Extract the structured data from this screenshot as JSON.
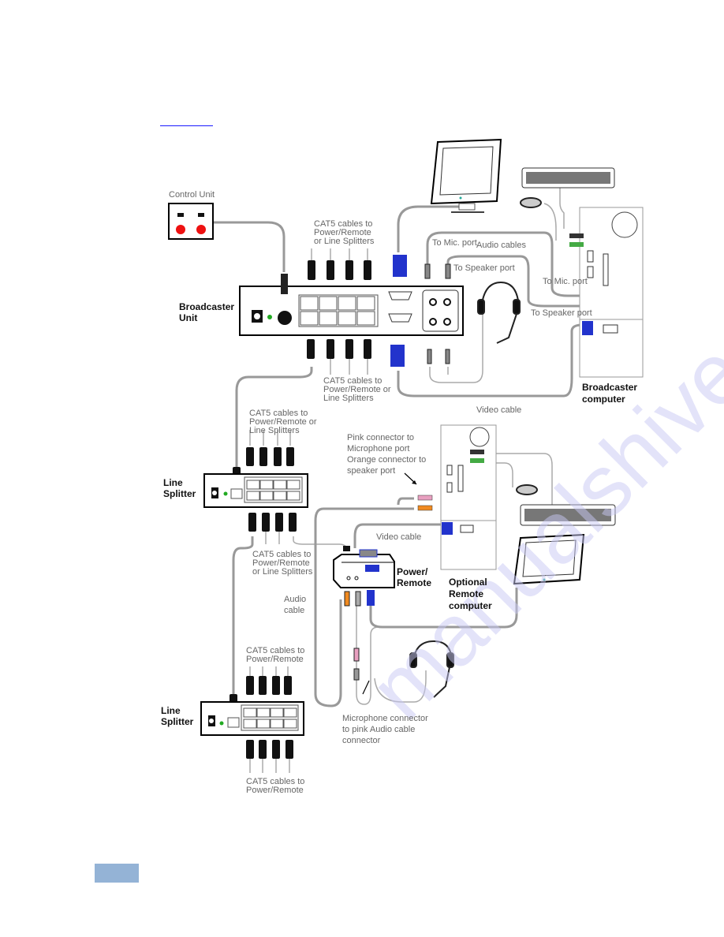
{
  "colors": {
    "link": "#1a1aff",
    "page_tab": "#94b3d6",
    "vga": "#2233cc",
    "led": "#22aa22",
    "button_red": "#ee1111",
    "pink": "#e8a0c0",
    "orange": "#f08a20",
    "green": "#44aa44"
  },
  "watermark": "manualshive.com",
  "labels": {
    "control_unit": "Control Unit",
    "broadcaster_unit": [
      "Broadcaster",
      "Unit"
    ],
    "cat5_top": [
      "CAT5 cables to",
      "Power/Remote",
      "or Line Splitters"
    ],
    "cat5_below_broadcaster": [
      "CAT5 cables to",
      "Power/Remote or",
      "Line Splitters"
    ],
    "to_mic_1": "To Mic. port",
    "audio_cables": "Audio cables",
    "to_speaker_1": "To Speaker port",
    "to_mic_2": "To Mic. port",
    "to_speaker_2": "To Speaker port",
    "broadcaster_computer": [
      "Broadcaster",
      "computer"
    ],
    "video_cable_1": "Video cable",
    "cat5_splitter1_top": [
      "CAT5 cables to",
      "Power/Remote or",
      "Line Splitters"
    ],
    "line_splitter_1": [
      "Line",
      "Splitter"
    ],
    "pink_orange": [
      "Pink connector to",
      "Microphone port",
      "Orange connector to",
      "speaker port"
    ],
    "video_cable_2": "Video cable",
    "cat5_splitter1_bottom": [
      "CAT5 cables to",
      "Power/Remote",
      "or Line Splitters"
    ],
    "power_remote": [
      "Power/",
      "Remote"
    ],
    "optional_remote": [
      "Optional",
      "Remote",
      "computer"
    ],
    "audio_cable": [
      "Audio",
      "cable"
    ],
    "cat5_splitter2_top": [
      "CAT5 cables to",
      "Power/Remote"
    ],
    "line_splitter_2": [
      "Line",
      "Splitter"
    ],
    "mic_connector": [
      "Microphone connector",
      "to pink Audio cable",
      "connector"
    ],
    "cat5_splitter2_bottom": [
      "CAT5 cables to",
      "Power/Remote"
    ]
  }
}
